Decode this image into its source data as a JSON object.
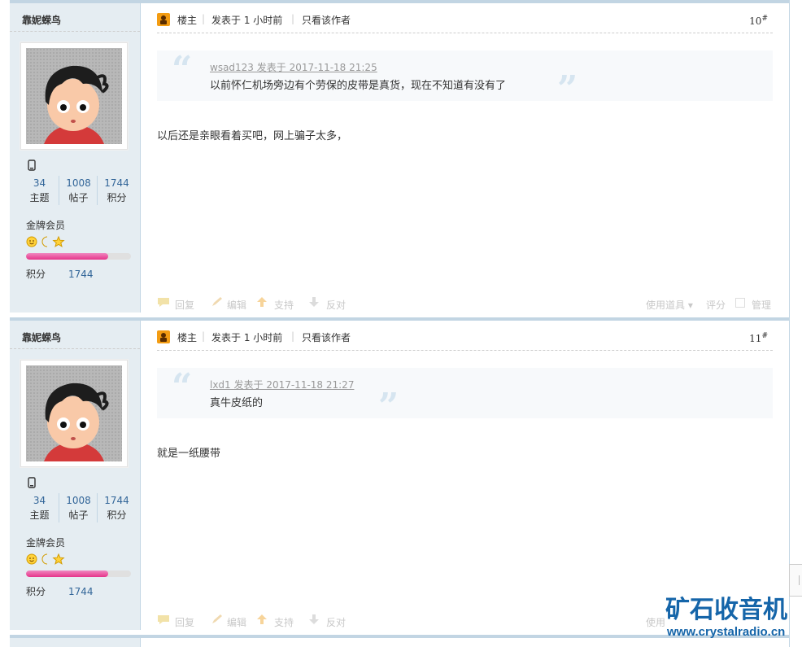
{
  "posts": [
    {
      "author": "靠妮蝾鸟",
      "stats": [
        {
          "num": "34",
          "label": "主题"
        },
        {
          "num": "1008",
          "label": "帖子"
        },
        {
          "num": "1744",
          "label": "积分"
        }
      ],
      "grade": "金牌会员",
      "progress": 0.78,
      "points_label": "积分",
      "points_value": "1744",
      "header": {
        "owner_label": "楼主",
        "posted": "发表于 1 小时前",
        "only_author": "只看该作者",
        "floor": "10",
        "floor_mark": "#"
      },
      "quote": {
        "meta": "wsad123 发表于 2017-11-18 21:25",
        "text": "以前怀仁机场旁边有个劳保的皮带是真货，现在不知道有没有了"
      },
      "body": "以后还是亲眼看着买吧，网上骗子太多，",
      "footer": {
        "reply": "回复",
        "edit": "编辑",
        "support": "支持",
        "oppose": "反对",
        "use_tool": "使用道具",
        "rate": "评分",
        "manage": "管理"
      }
    },
    {
      "author": "靠妮蝾鸟",
      "stats": [
        {
          "num": "34",
          "label": "主题"
        },
        {
          "num": "1008",
          "label": "帖子"
        },
        {
          "num": "1744",
          "label": "积分"
        }
      ],
      "grade": "金牌会员",
      "progress": 0.78,
      "points_label": "积分",
      "points_value": "1744",
      "header": {
        "owner_label": "楼主",
        "posted": "发表于 1 小时前",
        "only_author": "只看该作者",
        "floor": "11",
        "floor_mark": "#"
      },
      "quote": {
        "meta": "lxd1 发表于 2017-11-18 21:27",
        "text": "真牛皮纸的"
      },
      "body": "就是一纸腰带",
      "footer": {
        "reply": "回复",
        "edit": "编辑",
        "support": "支持",
        "oppose": "反对",
        "use_tool": "使用"
      }
    }
  ],
  "watermark": {
    "cn": "矿石收音机",
    "url": "www.crystalradio.cn"
  },
  "colors": {
    "sidebar_bg": "#e5edf2",
    "border": "#c2d5e3",
    "link_blue": "#336699",
    "brand_blue": "#1565a9",
    "progress_pink": "#e6348a"
  }
}
